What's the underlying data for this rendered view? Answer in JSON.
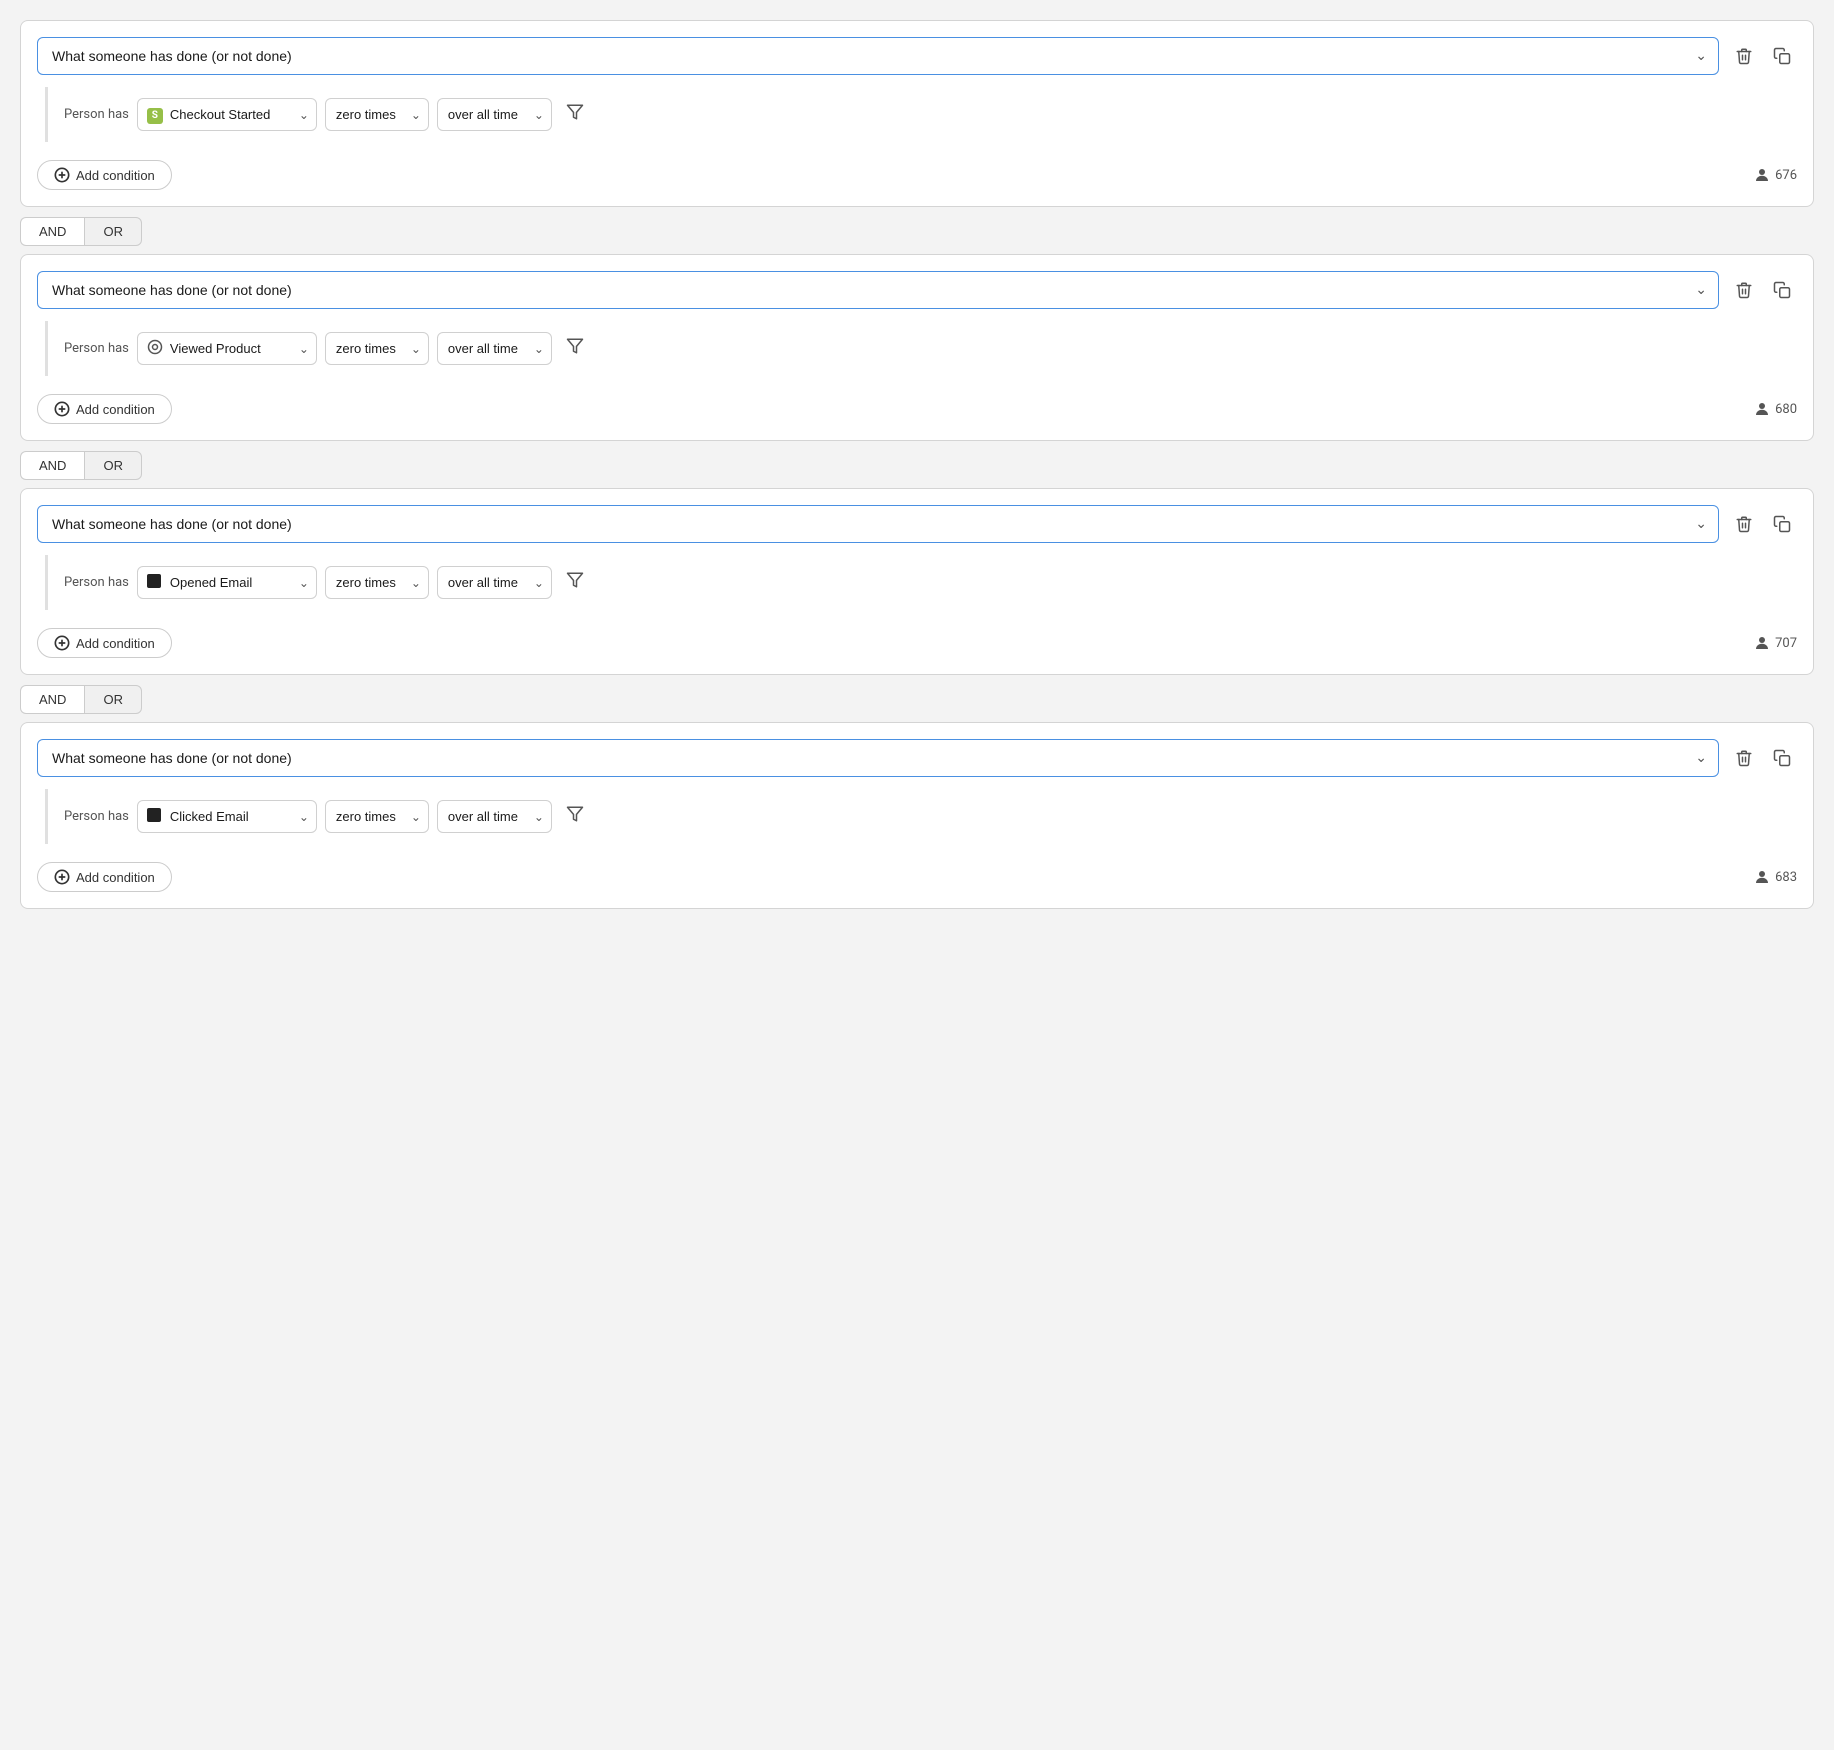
{
  "blocks": [
    {
      "id": "block1",
      "main_select_label": "What someone has done (or not done)",
      "person_has_label": "Person has",
      "event_icon_type": "shopify",
      "event_label": "Checkout Started",
      "frequency_label": "zero times",
      "time_label": "over all time",
      "add_condition_label": "Add condition",
      "count": "676"
    },
    {
      "id": "block2",
      "main_select_label": "What someone has done (or not done)",
      "person_has_label": "Person has",
      "event_icon_type": "settings",
      "event_label": "Viewed Product",
      "frequency_label": "zero times",
      "time_label": "over all time",
      "add_condition_label": "Add condition",
      "count": "680"
    },
    {
      "id": "block3",
      "main_select_label": "What someone has done (or not done)",
      "person_has_label": "Person has",
      "event_icon_type": "black-square",
      "event_label": "Opened Email",
      "frequency_label": "zero times",
      "time_label": "over all time",
      "add_condition_label": "Add condition",
      "count": "707"
    },
    {
      "id": "block4",
      "main_select_label": "What someone has done (or not done)",
      "person_has_label": "Person has",
      "event_icon_type": "black-square",
      "event_label": "Clicked Email",
      "frequency_label": "zero times",
      "time_label": "over all time",
      "add_condition_label": "Add condition",
      "count": "683"
    }
  ],
  "and_label": "AND",
  "or_label": "OR",
  "icons": {
    "delete": "🗑",
    "copy": "⧉",
    "chevron_down": "∨",
    "add": "+",
    "person": "👤",
    "filter": "⊘"
  }
}
